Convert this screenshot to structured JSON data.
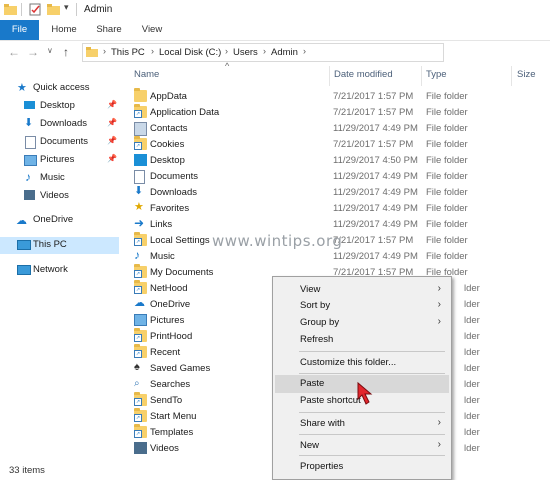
{
  "window": {
    "title": "Admin"
  },
  "ribbon": {
    "tabs": [
      "File",
      "Home",
      "Share",
      "View"
    ]
  },
  "address": {
    "crumbs": [
      "This PC",
      "Local Disk (C:)",
      "Users",
      "Admin"
    ]
  },
  "nav": {
    "items": [
      {
        "label": "Quick access",
        "icon": "star-icon"
      },
      {
        "label": "Desktop",
        "icon": "desktop-icon",
        "pinned": true
      },
      {
        "label": "Downloads",
        "icon": "download-icon",
        "pinned": true
      },
      {
        "label": "Documents",
        "icon": "documents-icon",
        "pinned": true
      },
      {
        "label": "Pictures",
        "icon": "pictures-icon",
        "pinned": true
      },
      {
        "label": "Music",
        "icon": "music-icon"
      },
      {
        "label": "Videos",
        "icon": "videos-icon"
      },
      {
        "label": "OneDrive",
        "icon": "cloud-icon"
      },
      {
        "label": "This PC",
        "icon": "pc-icon",
        "selected": true
      },
      {
        "label": "Network",
        "icon": "network-icon"
      }
    ]
  },
  "list": {
    "columns": [
      "Name",
      "Date modified",
      "Type",
      "Size"
    ],
    "rows": [
      {
        "name": "AppData",
        "date": "7/21/2017 1:57 PM",
        "type": "File folder",
        "icon": "folder-icon"
      },
      {
        "name": "Application Data",
        "date": "7/21/2017 1:57 PM",
        "type": "File folder",
        "icon": "folder-link-icon"
      },
      {
        "name": "Contacts",
        "date": "11/29/2017 4:49 PM",
        "type": "File folder",
        "icon": "contacts-icon"
      },
      {
        "name": "Cookies",
        "date": "7/21/2017 1:57 PM",
        "type": "File folder",
        "icon": "folder-link-icon"
      },
      {
        "name": "Desktop",
        "date": "11/29/2017 4:50 PM",
        "type": "File folder",
        "icon": "desktop-icon"
      },
      {
        "name": "Documents",
        "date": "11/29/2017 4:49 PM",
        "type": "File folder",
        "icon": "documents-icon"
      },
      {
        "name": "Downloads",
        "date": "11/29/2017 4:49 PM",
        "type": "File folder",
        "icon": "download-icon"
      },
      {
        "name": "Favorites",
        "date": "11/29/2017 4:49 PM",
        "type": "File folder",
        "icon": "star-icon"
      },
      {
        "name": "Links",
        "date": "11/29/2017 4:49 PM",
        "type": "File folder",
        "icon": "links-icon"
      },
      {
        "name": "Local Settings",
        "date": "7/21/2017 1:57 PM",
        "type": "File folder",
        "icon": "folder-link-icon"
      },
      {
        "name": "Music",
        "date": "11/29/2017 4:49 PM",
        "type": "File folder",
        "icon": "music-icon"
      },
      {
        "name": "My Documents",
        "date": "7/21/2017 1:57 PM",
        "type": "File folder",
        "icon": "folder-link-icon"
      },
      {
        "name": "NetHood",
        "date": "",
        "type": "",
        "icon": "folder-link-icon"
      },
      {
        "name": "OneDrive",
        "date": "",
        "type": "",
        "icon": "cloud-icon"
      },
      {
        "name": "Pictures",
        "date": "",
        "type": "",
        "icon": "pictures-icon"
      },
      {
        "name": "PrintHood",
        "date": "",
        "type": "",
        "icon": "folder-link-icon"
      },
      {
        "name": "Recent",
        "date": "",
        "type": "",
        "icon": "folder-link-icon"
      },
      {
        "name": "Saved Games",
        "date": "",
        "type": "",
        "icon": "saved-games-icon"
      },
      {
        "name": "Searches",
        "date": "",
        "type": "",
        "icon": "search-icon"
      },
      {
        "name": "SendTo",
        "date": "",
        "type": "",
        "icon": "folder-link-icon"
      },
      {
        "name": "Start Menu",
        "date": "",
        "type": "",
        "icon": "folder-link-icon"
      },
      {
        "name": "Templates",
        "date": "",
        "type": "",
        "icon": "folder-link-icon"
      },
      {
        "name": "Videos",
        "date": "",
        "type": "",
        "icon": "videos-icon"
      }
    ],
    "partial_type_text": "lder"
  },
  "context_menu": {
    "items": [
      {
        "label": "View",
        "submenu": true
      },
      {
        "label": "Sort by",
        "submenu": true
      },
      {
        "label": "Group by",
        "submenu": true
      },
      {
        "label": "Refresh"
      },
      {
        "label": "Customize this folder..."
      },
      {
        "label": "Paste",
        "highlighted": true
      },
      {
        "label": "Paste shortcut"
      },
      {
        "label": "Share with",
        "submenu": true
      },
      {
        "label": "New",
        "submenu": true
      },
      {
        "label": "Properties"
      }
    ]
  },
  "status": {
    "count": "33 items"
  },
  "watermark": "www.wintips.org",
  "colors": {
    "accent": "#1979ca",
    "selection": "#cce8ff",
    "folder": "#f7d06a",
    "pointer": "#e3262d"
  }
}
